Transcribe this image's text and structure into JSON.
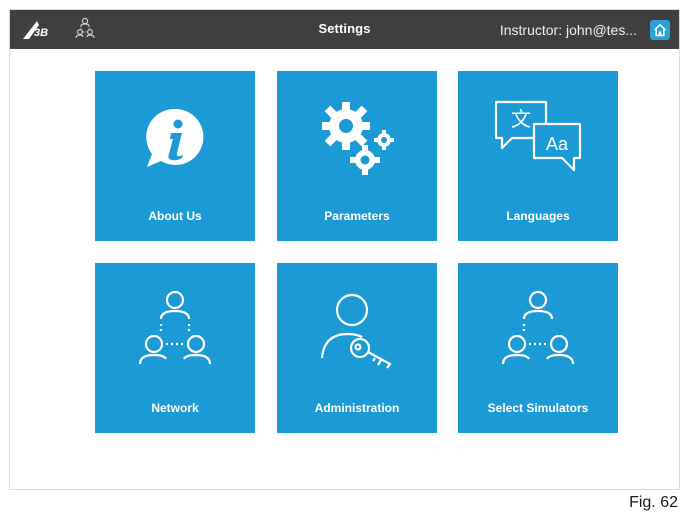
{
  "header": {
    "title": "Settings",
    "user": "Instructor: john@tes...",
    "logo_icon": "3b-logo-icon",
    "network_icon": "network-icon",
    "home_icon": "home-icon"
  },
  "tiles": [
    {
      "label": "About Us",
      "icon": "info-bubble-icon"
    },
    {
      "label": "Parameters",
      "icon": "gears-icon"
    },
    {
      "label": "Languages",
      "icon": "languages-icon"
    },
    {
      "label": "Network",
      "icon": "network-icon"
    },
    {
      "label": "Administration",
      "icon": "user-key-icon"
    },
    {
      "label": "Select Simulators",
      "icon": "select-simulators-icon"
    }
  ],
  "caption": "Fig. 62",
  "colors": {
    "topbar": "#3f3f3f",
    "tile": "#1b9ad6",
    "home_button": "#2aa0da"
  }
}
